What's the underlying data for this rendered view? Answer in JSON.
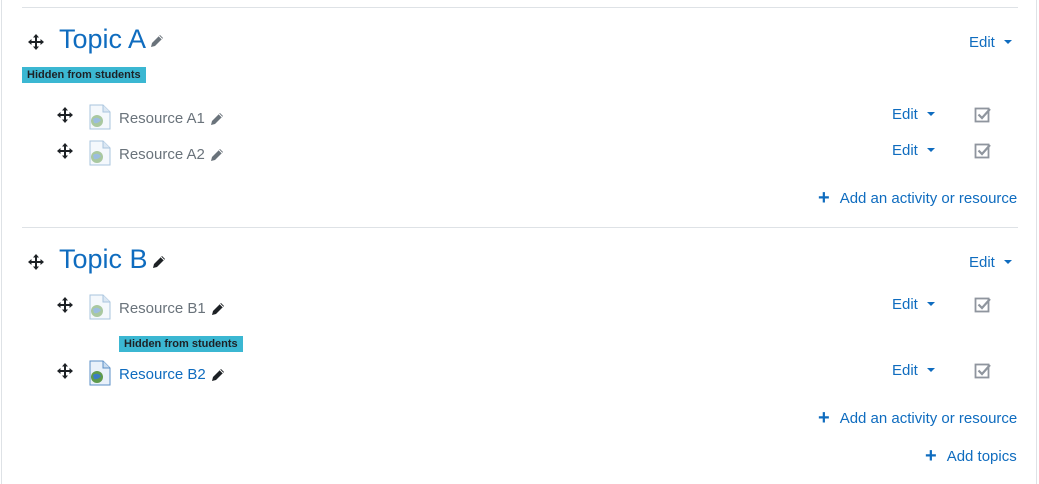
{
  "topics": [
    {
      "title": "Topic A",
      "badge": "Hidden from students",
      "edit_label": "Edit",
      "resources": [
        {
          "name": "Resource A1",
          "edit_label": "Edit"
        },
        {
          "name": "Resource A2",
          "edit_label": "Edit"
        }
      ],
      "add_label": "Add an activity or resource"
    },
    {
      "title": "Topic B",
      "edit_label": "Edit",
      "resources": [
        {
          "name": "Resource B1",
          "edit_label": "Edit",
          "badge": "Hidden from students"
        },
        {
          "name": "Resource B2",
          "edit_label": "Edit"
        }
      ],
      "add_label": "Add an activity or resource"
    }
  ],
  "add_topics_label": "Add topics",
  "colors": {
    "link": "#0f6cbf",
    "badge": "#3bb7d2",
    "muted": "#6a737b"
  },
  "icons": [
    "move-icon",
    "pencil-icon",
    "file-icon",
    "checkbox-icon",
    "plus-icon",
    "caret-down-icon"
  ]
}
